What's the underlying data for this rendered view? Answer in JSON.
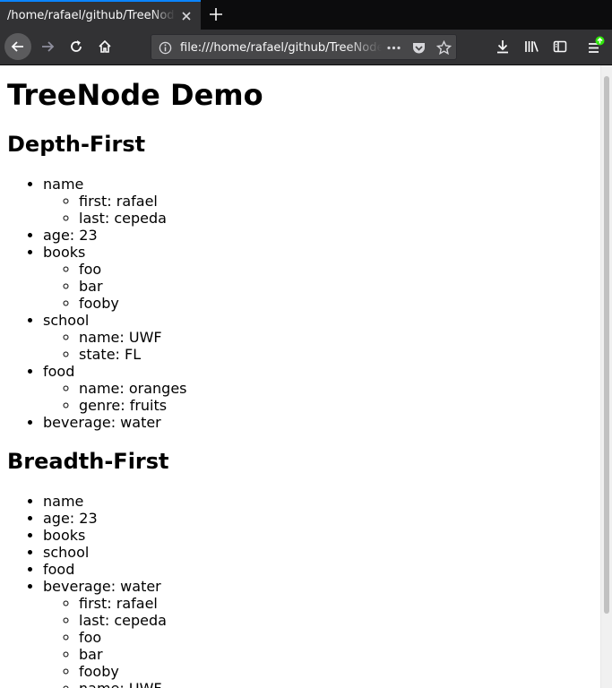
{
  "browser": {
    "tab_title": "/home/rafael/github/TreeNode",
    "url": "file:///home/rafael/github/TreeNode/index.html"
  },
  "page": {
    "title": "TreeNode Demo",
    "depth_first": {
      "heading": "Depth-First",
      "items": [
        {
          "label": "name",
          "children": [
            "first: rafael",
            "last: cepeda"
          ]
        },
        {
          "label": "age: 23",
          "children": []
        },
        {
          "label": "books",
          "children": [
            "foo",
            "bar",
            "fooby"
          ]
        },
        {
          "label": "school",
          "children": [
            "name: UWF",
            "state: FL"
          ]
        },
        {
          "label": "food",
          "children": [
            "name: oranges",
            "genre: fruits"
          ]
        },
        {
          "label": "beverage: water",
          "children": []
        }
      ]
    },
    "breadth_first": {
      "heading": "Breadth-First",
      "items": [
        {
          "label": "name",
          "children": []
        },
        {
          "label": "age: 23",
          "children": []
        },
        {
          "label": "books",
          "children": []
        },
        {
          "label": "school",
          "children": []
        },
        {
          "label": "food",
          "children": []
        },
        {
          "label": "beverage: water",
          "children": [
            "first: rafael",
            "last: cepeda",
            "foo",
            "bar",
            "fooby",
            "name: UWF"
          ]
        }
      ]
    }
  },
  "icons": {
    "back": "back-arrow-icon",
    "forward": "forward-arrow-icon",
    "reload": "reload-icon",
    "home": "home-icon",
    "info": "info-icon",
    "page_actions": "more-icon",
    "pocket": "pocket-icon",
    "bookmark": "star-icon",
    "downloads": "download-icon",
    "library": "library-icon",
    "sidebar": "sidebar-icon",
    "menu": "hamburger-menu-icon"
  },
  "colors": {
    "chrome_dark": "#0c0c0d",
    "chrome": "#323234",
    "accent": "#0a84ff",
    "update_badge": "#30e60b"
  }
}
